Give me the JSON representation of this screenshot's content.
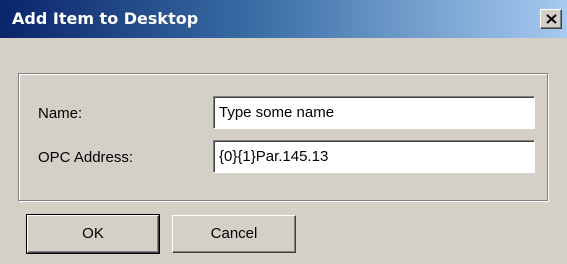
{
  "window": {
    "title": "Add Item to Desktop",
    "close_glyph": "close-icon"
  },
  "form": {
    "name_label": "Name:",
    "name_value": "Type some name",
    "address_label": "OPC Address:",
    "address_value": "{0}{1}Par.145.13"
  },
  "buttons": {
    "ok_label": "OK",
    "cancel_label": "Cancel"
  }
}
